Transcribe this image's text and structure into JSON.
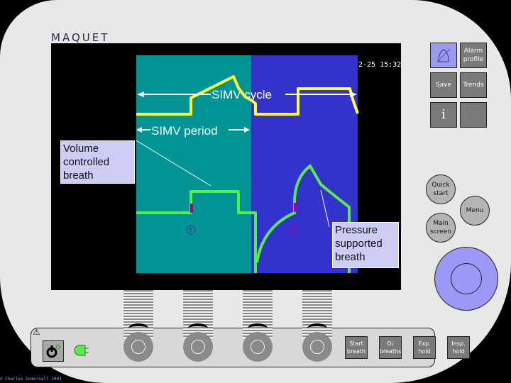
{
  "brand": {
    "logo": "MAQUET"
  },
  "screen": {
    "timestamp": "2-25 15:32",
    "labels": {
      "simv_cycle": "SIMV cycle",
      "simv_period": "SIMV period"
    },
    "callouts": {
      "volume_controlled": "Volume controlled breath",
      "pressure_supported": "Pressure supported breath"
    },
    "colors": {
      "simv_period_bg": "#009494",
      "cycle_bg": "#3333cc",
      "pressure_wave": "#ffff33",
      "flow_wave": "#55ee44",
      "trigger_mark": "#aa0088",
      "callout_bg": "#ccccf4"
    },
    "trigger_icons": [
      "trigger-icon",
      "trigger-icon"
    ]
  },
  "side_buttons": {
    "alarm_silence": {
      "icon": "bell-muted-icon"
    },
    "alarm_profile": "Alarm profile",
    "save": "Save",
    "trends": "Trends",
    "info": "i",
    "blank": ""
  },
  "round_buttons": {
    "quick_start": "Quick start",
    "menu": "Menu",
    "main_screen": "Main screen"
  },
  "knob": {
    "icon": "main-rotary-knob"
  },
  "bottom_bar": {
    "warning_icon": "⚠",
    "power_icon": "power-icon",
    "status_led": "on",
    "dial_count": 4,
    "buttons": [
      "Start breath",
      "O₂ breaths",
      "Exp. hold",
      "Insp. hold"
    ]
  },
  "footer": {
    "copyright": "© Charles Gomersall 2003"
  }
}
